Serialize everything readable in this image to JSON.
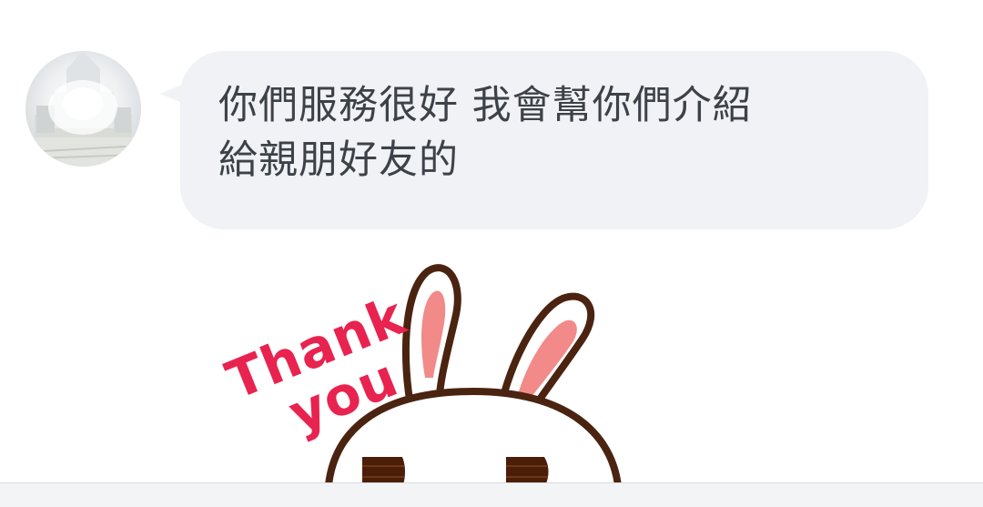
{
  "message": {
    "line1": "你們服務很好 我會幫你們介紹",
    "line2": "給親朋好友的"
  },
  "sticker": {
    "icon": "thank-you-rabbit-sticker",
    "text_line1": "Thank",
    "text_line2": "you",
    "text_color": "#e8234f"
  },
  "colors": {
    "bubble_bg": "#f0f2f5",
    "message_text": "#3d4148"
  }
}
